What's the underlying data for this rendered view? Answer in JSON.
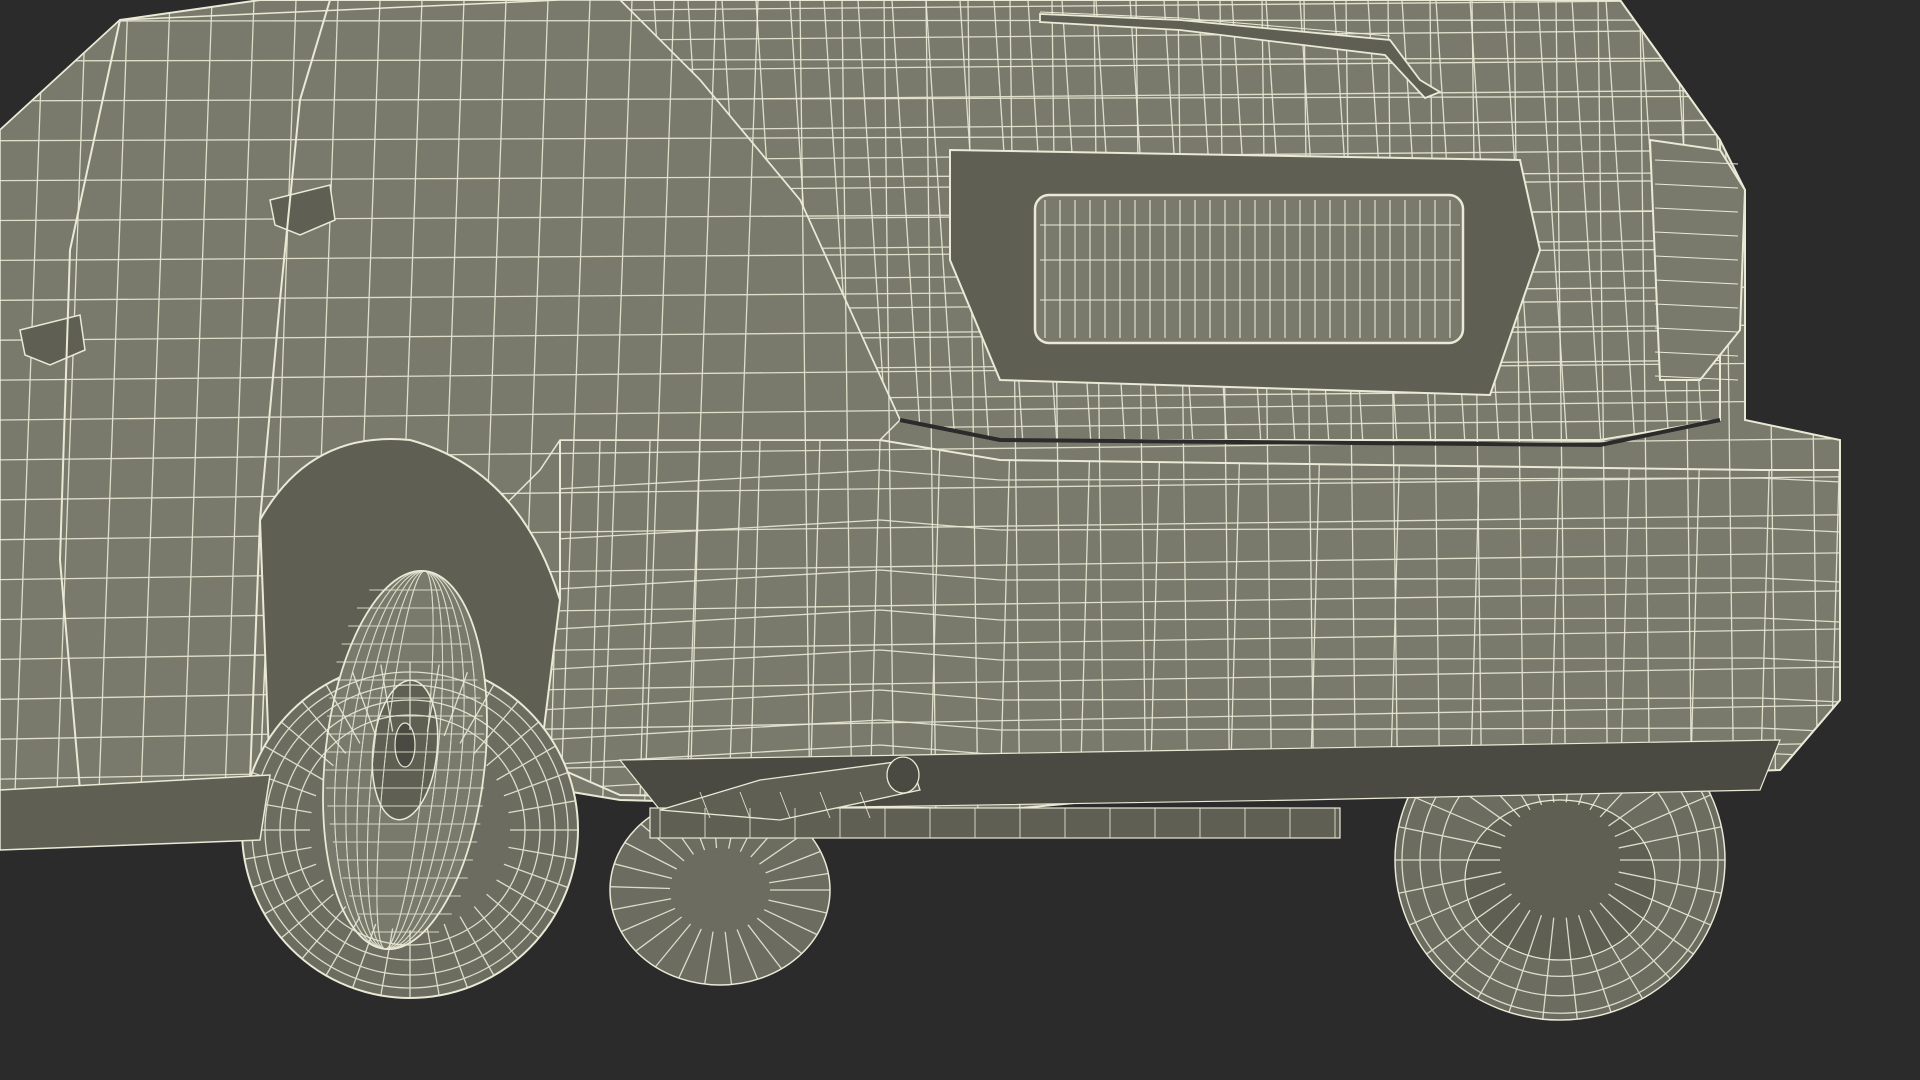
{
  "scene": {
    "subject": "car-rear-wireframe-render",
    "view": "rear-three-quarter",
    "colors": {
      "background": "#2b2b2b",
      "surface": "#7a7a6c",
      "surface_shadow": "#5f5f54",
      "surface_dark": "#4a4a42",
      "wire": "#e9e9d6",
      "tire": "#6c6c60"
    }
  }
}
